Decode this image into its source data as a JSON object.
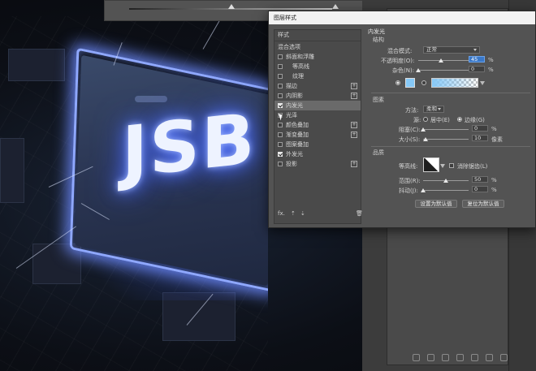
{
  "dialog": {
    "title": "图层样式"
  },
  "sidebar": {
    "items": [
      {
        "label": "样式",
        "checkbox": false,
        "checked": false,
        "plus": false,
        "sub": false,
        "head": true
      },
      {
        "label": "混合选项",
        "checkbox": false,
        "checked": false,
        "plus": false,
        "sub": false,
        "head": true
      },
      {
        "label": "斜面和浮雕",
        "checkbox": true,
        "checked": false,
        "plus": false,
        "sub": false
      },
      {
        "label": "等高线",
        "checkbox": true,
        "checked": false,
        "plus": false,
        "sub": true
      },
      {
        "label": "纹理",
        "checkbox": true,
        "checked": false,
        "plus": false,
        "sub": true
      },
      {
        "label": "描边",
        "checkbox": true,
        "checked": false,
        "plus": true,
        "sub": false
      },
      {
        "label": "内阴影",
        "checkbox": true,
        "checked": false,
        "plus": true,
        "sub": false
      },
      {
        "label": "内发光",
        "checkbox": true,
        "checked": true,
        "plus": false,
        "sub": false,
        "selected": true
      },
      {
        "label": "光泽",
        "checkbox": true,
        "checked": false,
        "plus": false,
        "sub": false
      },
      {
        "label": "颜色叠加",
        "checkbox": true,
        "checked": false,
        "plus": true,
        "sub": false
      },
      {
        "label": "渐变叠加",
        "checkbox": true,
        "checked": false,
        "plus": true,
        "sub": false
      },
      {
        "label": "图案叠加",
        "checkbox": true,
        "checked": false,
        "plus": false,
        "sub": false
      },
      {
        "label": "外发光",
        "checkbox": true,
        "checked": true,
        "plus": false,
        "sub": false
      },
      {
        "label": "投影",
        "checkbox": true,
        "checked": false,
        "plus": true,
        "sub": false
      }
    ],
    "footer": {
      "fx": "fx.",
      "up": "⇡",
      "down": "⇣",
      "trash": "🗑"
    }
  },
  "inner_glow": {
    "section": "内发光",
    "structure": "结构",
    "blend_mode_label": "混合模式:",
    "blend_mode_value": "正常",
    "opacity_label": "不透明度(O):",
    "opacity_value": "45",
    "opacity_fraction": 0.45,
    "noise_label": "杂色(N):",
    "noise_value": "0",
    "noise_fraction": 0.0,
    "unit_percent": "%",
    "glow_color": "#86c8f6",
    "elements": "图素",
    "method_label": "方法:",
    "method_value": "柔和",
    "source_label": "源:",
    "source_center": "居中(E)",
    "source_edge": "边缘(G)",
    "choke_label": "阻塞(C):",
    "choke_value": "0",
    "choke_fraction": 0.0,
    "size_label": "大小(S):",
    "size_value": "10",
    "size_fraction": 0.06,
    "size_unit": "像素",
    "quality": "品质",
    "contour_label": "等高线:",
    "antialias_label": "消除锯齿(L)",
    "range_label": "范围(R):",
    "range_value": "50",
    "range_fraction": 0.5,
    "jitter_label": "抖动(J):",
    "jitter_value": "0",
    "jitter_fraction": 0.0,
    "btn_default": "设置为默认值",
    "btn_reset": "复位为默认值"
  },
  "artwork": {
    "chip_text": "JSB"
  }
}
